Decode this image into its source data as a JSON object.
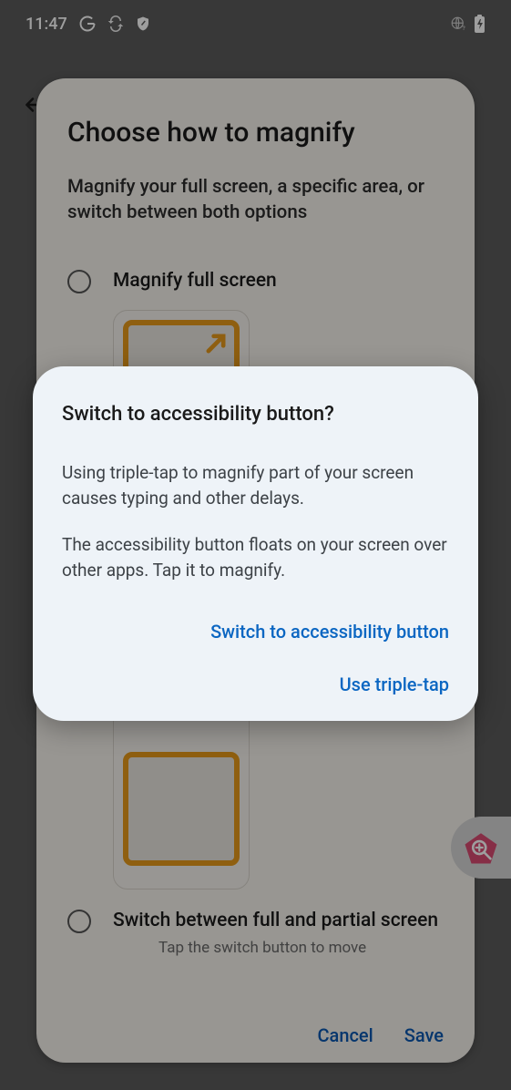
{
  "statusbar": {
    "time": "11:47"
  },
  "sheet": {
    "title": "Choose how to magnify",
    "subtitle": "Magnify your full screen, a specific area, or switch between both options",
    "option1_label": "Magnify full screen",
    "option2_label": "Switch between full and partial screen",
    "option2_hint": "Tap the switch button to move",
    "cancel": "Cancel",
    "save": "Save"
  },
  "dialog": {
    "title": "Switch to accessibility button?",
    "body1": "Using triple-tap to magnify part of your screen causes typing and other delays.",
    "body2": "The accessibility button floats on your screen over other apps. Tap it to magnify.",
    "primary": "Switch to accessibility button",
    "secondary": "Use triple-tap"
  }
}
